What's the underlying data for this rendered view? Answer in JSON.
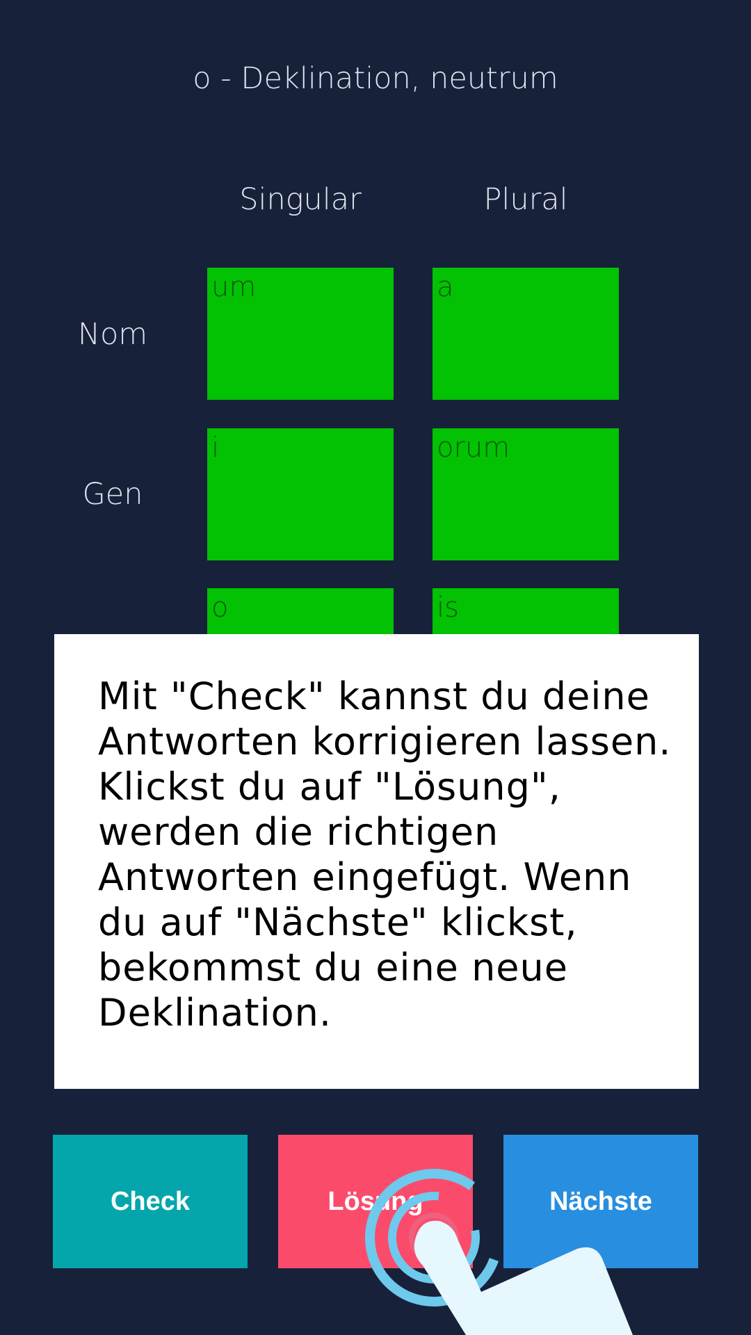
{
  "header": {
    "title": "o - Deklination, neutrum"
  },
  "table": {
    "columns": [
      "Singular",
      "Plural"
    ],
    "rows": [
      {
        "label": "Nom",
        "singular": "um",
        "plural": "a"
      },
      {
        "label": "Gen",
        "singular": "i",
        "plural": "orum"
      },
      {
        "label": "",
        "singular": "o",
        "plural": "is"
      }
    ]
  },
  "dialog": {
    "text": "Mit \"Check\" kannst du deine Antworten korrigieren lassen. Klickst du auf \"Lösung\", werden die richtigen Antworten eingefügt. Wenn du auf \"Nächste\" klickst, bekommst du eine neue Deklination."
  },
  "buttons": {
    "check": "Check",
    "solution": "Lösung",
    "next": "Nächste"
  },
  "colors": {
    "background": "#18213a",
    "cell": "#03c103",
    "check": "#05a6ab",
    "solution": "#fb4b6b",
    "next": "#288edf"
  },
  "icons": {
    "tap_hint": "tap-hand-icon"
  }
}
